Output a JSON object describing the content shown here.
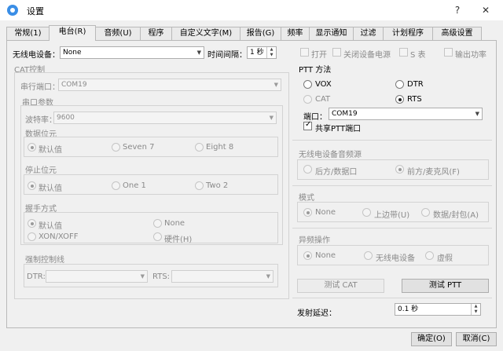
{
  "window": {
    "title": "设置",
    "help": "?",
    "close": "✕"
  },
  "tabs": [
    "常规(1)",
    "电台(R)",
    "音频(U)",
    "程序",
    "自定义文字(M)",
    "报告(G)",
    "频率",
    "显示通知",
    "过滤",
    "计划程序",
    "高级设置"
  ],
  "top": {
    "rig_label": "无线电设备：",
    "rig_value": "None",
    "interval_label": "时间间隔：",
    "interval_value": "1 秒",
    "open_label": "打开",
    "close_power_label": "关闭设备电源",
    "s_table_label": "S 表",
    "output_power_label": "输出功率"
  },
  "cat": {
    "title": "CAT控制",
    "serial_port_label": "串行端口：",
    "serial_port_value": "COM19",
    "serial_params_title": "串口参数",
    "baud_label": "波特率：",
    "baud_value": "9600",
    "data_bits_title": "数据位元",
    "data_bits": [
      "默认值",
      "Seven 7",
      "Eight 8"
    ],
    "stop_bits_title": "停止位元",
    "stop_bits": [
      "默认值",
      "One 1",
      "Two 2"
    ],
    "handshake_title": "握手方式",
    "handshake": [
      "默认值",
      "None",
      "XON/XOFF",
      "硬件(H)"
    ],
    "force_lines_title": "强制控制线",
    "dtr_label": "DTR:",
    "rts_label": "RTS:"
  },
  "ptt": {
    "title": "PTT 方法",
    "options": [
      "VOX",
      "DTR",
      "CAT",
      "RTS"
    ],
    "port_label": "端口：",
    "port_value": "COM19",
    "share_label": "共享PTT端口"
  },
  "audio_src": {
    "title": "无线电设备音频源",
    "options": [
      "后方/数据口",
      "前方/麦克风(F)"
    ]
  },
  "mode": {
    "title": "模式",
    "options": [
      "None",
      "上边带(U)",
      "数据/封包(A)"
    ]
  },
  "split": {
    "title": "异频操作",
    "options": [
      "None",
      "无线电设备",
      "虚假"
    ]
  },
  "buttons": {
    "test_cat": "测试 CAT",
    "test_ptt": "测试 PTT",
    "ok": "确定(O)",
    "cancel": "取消(C)"
  },
  "tx_delay": {
    "label": "发射延迟：",
    "value": "0.1 秒"
  },
  "colors": {
    "accent": "#0078d7",
    "window_bg": "#f0f0f0"
  }
}
